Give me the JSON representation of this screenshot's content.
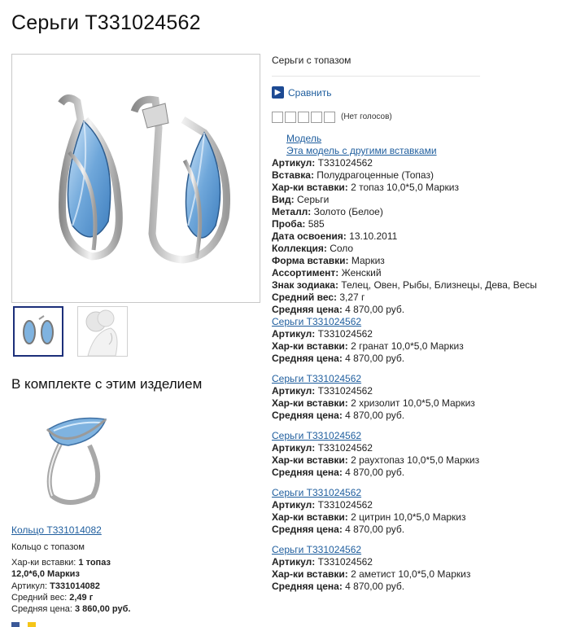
{
  "product": {
    "title": "Серьги T331024562",
    "subtitle": "Серьги с топазом",
    "compare_label": "Сравнить",
    "votes": "(Нет голосов)",
    "link_model": "Модель",
    "link_other": "Эта модель с другими вставками",
    "specs": [
      {
        "k": "Артикул:",
        "v": " T331024562"
      },
      {
        "k": "Вставка:",
        "v": " Полудрагоценные (Топаз)"
      },
      {
        "k": "Хар-ки вставки:",
        "v": " 2 топаз 10,0*5,0 Маркиз"
      },
      {
        "k": "Вид:",
        "v": " Серьги"
      },
      {
        "k": "Металл:",
        "v": " Золото (Белое)"
      },
      {
        "k": "Проба:",
        "v": " 585"
      },
      {
        "k": "Дата освоения:",
        "v": " 13.10.2011"
      },
      {
        "k": "Коллекция:",
        "v": " Соло"
      },
      {
        "k": "Форма вставки:",
        "v": " Маркиз"
      },
      {
        "k": "Ассортимент:",
        "v": " Женский"
      },
      {
        "k": "Знак зодиака:",
        "v": " Телец, Овен, Рыбы, Близнецы, Дева, Весы"
      },
      {
        "k": "Средний вес:",
        "v": " 3,27 г"
      },
      {
        "k": "Средняя цена:",
        "v": " 4 870,00 руб."
      }
    ]
  },
  "variants": [
    {
      "name": "Серьги T331024562",
      "art_k": "Артикул:",
      "art_v": " T331024562",
      "ins_k": "Хар-ки вставки:",
      "ins_v": " 2 гранат 10,0*5,0 Маркиз",
      "price_k": "Средняя цена:",
      "price_v": " 4 870,00 руб."
    },
    {
      "name": "Серьги T331024562",
      "art_k": "Артикул:",
      "art_v": " T331024562",
      "ins_k": "Хар-ки вставки:",
      "ins_v": " 2 хризолит 10,0*5,0 Маркиз",
      "price_k": "Средняя цена:",
      "price_v": " 4 870,00 руб."
    },
    {
      "name": "Серьги T331024562",
      "art_k": "Артикул:",
      "art_v": " T331024562",
      "ins_k": "Хар-ки вставки:",
      "ins_v": " 2 раухтопаз 10,0*5,0 Маркиз",
      "price_k": "Средняя цена:",
      "price_v": " 4 870,00 руб."
    },
    {
      "name": "Серьги T331024562",
      "art_k": "Артикул:",
      "art_v": " T331024562",
      "ins_k": "Хар-ки вставки:",
      "ins_v": " 2 цитрин 10,0*5,0 Маркиз",
      "price_k": "Средняя цена:",
      "price_v": " 4 870,00 руб."
    },
    {
      "name": "Серьги T331024562",
      "art_k": "Артикул:",
      "art_v": " T331024562",
      "ins_k": "Хар-ки вставки:",
      "ins_v": " 2 аметист 10,0*5,0 Маркиз",
      "price_k": "Средняя цена:",
      "price_v": " 4 870,00 руб."
    }
  ],
  "set": {
    "title": "В комплекте с этим изделием",
    "ring_link": "Кольцо T331014082",
    "ring_desc": "Кольцо с топазом",
    "ins_k": "Хар-ки вставки:",
    "ins_v1": " 1 топаз",
    "ins_v2": "12,0*6,0 Маркиз",
    "art_k": "Артикул:",
    "art_v": " T331014082",
    "weight_k": "Средний вес:",
    "weight_v": " 2,49 г",
    "price_k": "Средняя цена:",
    "price_v": " 3 860,00 руб."
  },
  "colors": {
    "link": "#1f5e9e",
    "topaz": "#7fb3e0",
    "compare_btn": "#1d4a93"
  }
}
